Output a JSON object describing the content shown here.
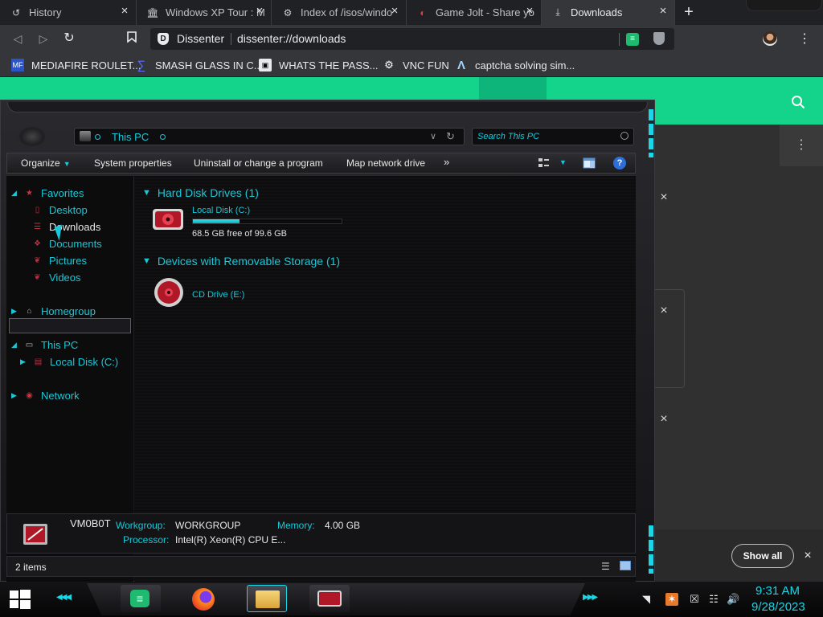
{
  "browser": {
    "tabs": [
      {
        "title": "History",
        "icon": "history-icon"
      },
      {
        "title": "Windows XP Tour : M",
        "icon": "archive-org-icon"
      },
      {
        "title": "Index of /isos/windo",
        "icon": "server-icon"
      },
      {
        "title": "Game Jolt - Share yo",
        "icon": "gamejolt-icon"
      },
      {
        "title": "Downloads",
        "icon": "download-icon"
      }
    ],
    "omnibox": {
      "site": "Dissenter",
      "url": "dissenter://downloads"
    },
    "bookmarks": [
      {
        "label": "MEDIAFIRE ROULET...",
        "icon": "mediafire-icon",
        "badge": "MF"
      },
      {
        "label": "SMASH GLASS IN C...",
        "icon": "bracket-icon"
      },
      {
        "label": "WHATS THE PASS...",
        "icon": "ghost-icon"
      },
      {
        "label": "VNC FUN",
        "icon": "vnc-icon"
      },
      {
        "label": "captcha solving sim...",
        "icon": "lambda-icon"
      }
    ]
  },
  "downloads_page": {
    "show_all": "Show all"
  },
  "explorer": {
    "address": "This PC",
    "search_placeholder": "Search This PC",
    "commands": {
      "organize": "Organize",
      "system_properties": "System properties",
      "uninstall": "Uninstall or change a program",
      "map_drive": "Map network drive",
      "more": "»"
    },
    "nav": {
      "favorites": "Favorites",
      "desktop": "Desktop",
      "downloads": "Downloads",
      "documents": "Documents",
      "pictures": "Pictures",
      "videos": "Videos",
      "homegroup": "Homegroup",
      "this_pc": "This PC",
      "local_disk": "Local Disk (C:)",
      "network": "Network"
    },
    "groups": {
      "hdd": "Hard Disk Drives (1)",
      "removable": "Devices with Removable Storage (1)"
    },
    "drives": {
      "c_name": "Local Disk (C:)",
      "c_free": "68.5 GB free of 99.6 GB",
      "c_used_fraction": 0.312,
      "e_name": "CD Drive (E:)"
    },
    "details": {
      "computer": "VM0B0T",
      "workgroup_label": "Workgroup:",
      "workgroup": "WORKGROUP",
      "memory_label": "Memory:",
      "memory": "4.00 GB",
      "processor_label": "Processor:",
      "processor": "Intel(R) Xeon(R) CPU E..."
    },
    "status": "2 items"
  },
  "taskbar": {
    "time": "9:31 AM",
    "date": "9/28/2023",
    "accent": "#19d7e6"
  }
}
